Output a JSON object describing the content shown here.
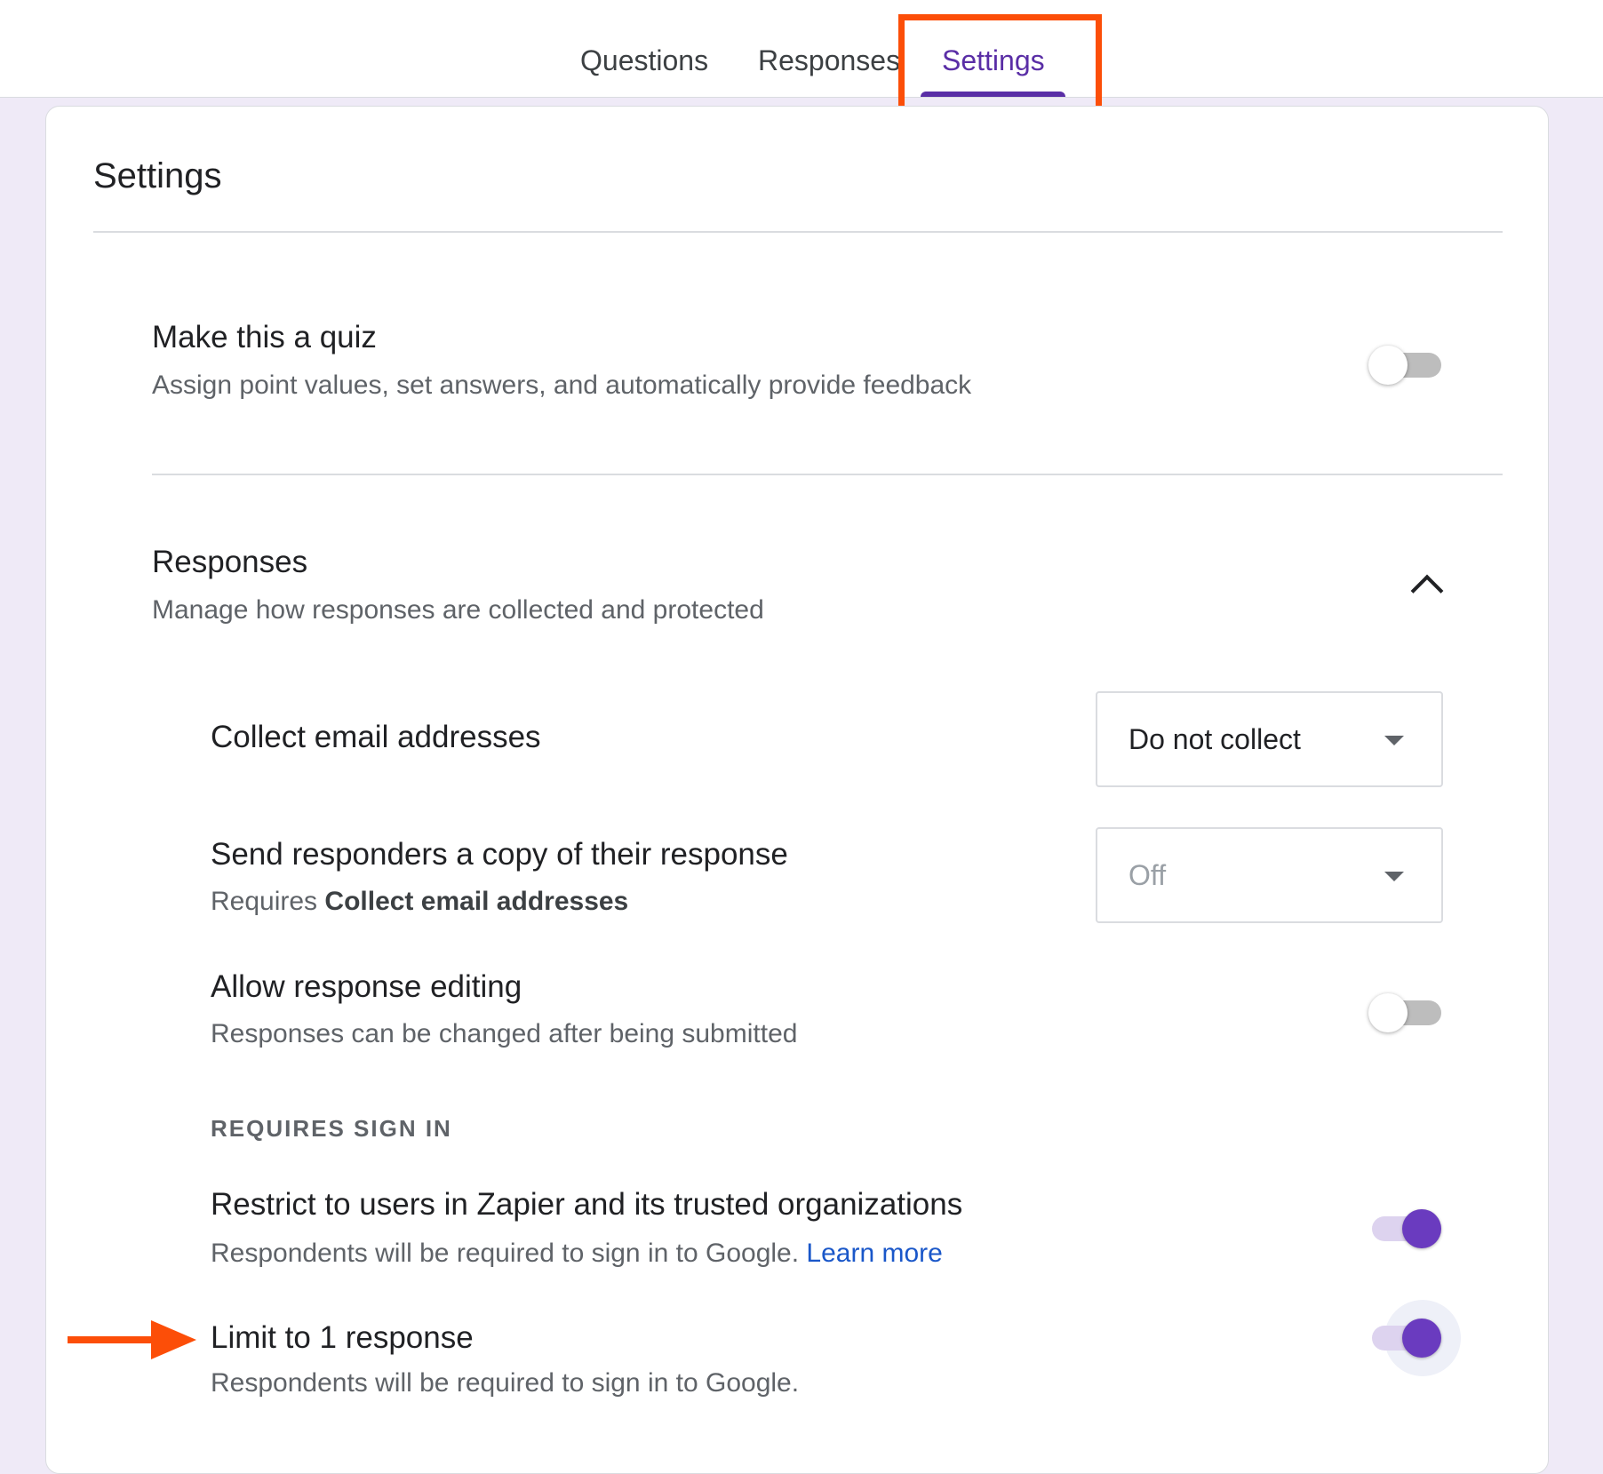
{
  "tabs": [
    {
      "label": "Questions",
      "active": false
    },
    {
      "label": "Responses",
      "active": false
    },
    {
      "label": "Settings",
      "active": true
    }
  ],
  "settings": {
    "title": "Settings",
    "quiz": {
      "title": "Make this a quiz",
      "description": "Assign point values, set answers, and automatically provide feedback",
      "enabled": false
    },
    "responses": {
      "title": "Responses",
      "description": "Manage how responses are collected and protected",
      "expanded": true,
      "collect_email": {
        "label": "Collect email addresses",
        "value": "Do not collect"
      },
      "send_copy": {
        "label": "Send responders a copy of their response",
        "requires_prefix": "Requires",
        "requires_bold": "Collect email addresses",
        "value": "Off",
        "disabled": true
      },
      "allow_editing": {
        "label": "Allow response editing",
        "description": "Responses can be changed after being submitted",
        "enabled": false
      },
      "requires_sign_in_header": "REQUIRES SIGN IN",
      "restrict": {
        "label": "Restrict to users in Zapier and its trusted organizations",
        "description": "Respondents will be required to sign in to Google.",
        "link": "Learn more",
        "enabled": true
      },
      "limit_one": {
        "label": "Limit to 1 response",
        "description": "Respondents will be required to sign in to Google.",
        "enabled": true
      }
    }
  },
  "colors": {
    "accent": "#6a3bbf",
    "tab_active": "#5a2ea6",
    "annotation": "#fc4e08",
    "link": "#1a57c9"
  },
  "icons": {
    "collapse": "chevron-up-icon",
    "dropdown": "caret-down-icon",
    "annotation": "arrow-right-icon"
  }
}
